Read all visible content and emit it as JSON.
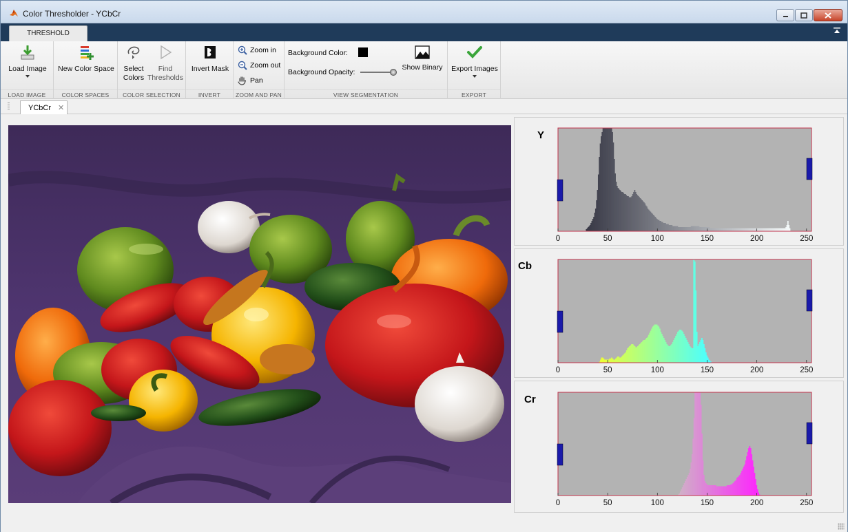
{
  "window": {
    "title": "Color Thresholder - YCbCr"
  },
  "tabs": {
    "threshold_label": "THRESHOLD"
  },
  "ribbon": {
    "load_image": "Load Image",
    "new_color_space": "New Color Space",
    "select_colors_1": "Select",
    "select_colors_2": "Colors",
    "find_thresholds_1": "Find",
    "find_thresholds_2": "Thresholds",
    "invert_mask": "Invert Mask",
    "zoom_in": "Zoom in",
    "zoom_out": "Zoom out",
    "pan": "Pan",
    "background_color": "Background Color:",
    "background_color_value": "#000000",
    "background_opacity": "Background Opacity:",
    "background_opacity_level": 1.0,
    "show_binary": "Show Binary",
    "export_images": "Export Images",
    "groups": {
      "load_image": "LOAD IMAGE",
      "color_spaces": "COLOR SPACES",
      "color_selection": "COLOR SELECTION",
      "invert": "INVERT",
      "zoom_and_pan": "ZOOM AND PAN",
      "view_segmentation": "VIEW SEGMENTATION",
      "export": "EXPORT"
    }
  },
  "document": {
    "tab_label": "YCbCr"
  },
  "histograms": {
    "ticks": [
      "0",
      "50",
      "100",
      "150",
      "200",
      "250"
    ],
    "y": {
      "label": "Y"
    },
    "cb": {
      "label": "Cb"
    },
    "cr": {
      "label": "Cr"
    }
  },
  "colors": {
    "slider_handle": "#1a1aaa",
    "histogram_background": "#b3b3b3",
    "histogram_border": "#c0304a"
  },
  "chart_data": [
    {
      "type": "area",
      "series": [
        {
          "name": "Y",
          "values": [
            0,
            0,
            0,
            0,
            0,
            0,
            0,
            0,
            0,
            0,
            0,
            0,
            0,
            0,
            0,
            0,
            0,
            0,
            0,
            0,
            0,
            0,
            0,
            0,
            0,
            0,
            0,
            0,
            0,
            0,
            2,
            3,
            4,
            5,
            6,
            8,
            10,
            12,
            14,
            18,
            22,
            30,
            40,
            55,
            72,
            85,
            92,
            96,
            100,
            100,
            100,
            100,
            100,
            100,
            100,
            100,
            100,
            100,
            96,
            86,
            70,
            56,
            48,
            44,
            42,
            41,
            40,
            39,
            38,
            38,
            37,
            36,
            36,
            35,
            34,
            34,
            33,
            33,
            33,
            34,
            36,
            38,
            40,
            38,
            36,
            35,
            34,
            33,
            32,
            31,
            30,
            29,
            28,
            27,
            25,
            24,
            22,
            21,
            20,
            19,
            18,
            17,
            16,
            15,
            14,
            13,
            12,
            11,
            11,
            10,
            10,
            9,
            9,
            8,
            8,
            8,
            7,
            7,
            7,
            6,
            6,
            6,
            6,
            5,
            5,
            5,
            5,
            5,
            5,
            4,
            4,
            4,
            4,
            4,
            4,
            4,
            4,
            4,
            4,
            4,
            4,
            4,
            4,
            5,
            5,
            5,
            5,
            5,
            5,
            5,
            5,
            5,
            4,
            4,
            4,
            4,
            4,
            4,
            4,
            4,
            4,
            4,
            4,
            3,
            3,
            3,
            3,
            3,
            3,
            3,
            3,
            3,
            3,
            3,
            3,
            3,
            3,
            3,
            3,
            3,
            3,
            3,
            3,
            3,
            3,
            3,
            3,
            3,
            3,
            3,
            3,
            3,
            3,
            3,
            3,
            3,
            3,
            3,
            3,
            3,
            3,
            3,
            3,
            3,
            3,
            3,
            3,
            3,
            3,
            3,
            3,
            3,
            3,
            3,
            3,
            3,
            3,
            3,
            3,
            3,
            3,
            3,
            3,
            3,
            3,
            3,
            3,
            3,
            3,
            3,
            3,
            3,
            3,
            3,
            3,
            3,
            3,
            3,
            3,
            3,
            3,
            3,
            3,
            3,
            3,
            4,
            6,
            10,
            6,
            3,
            0,
            0,
            0,
            0,
            0,
            0,
            0,
            0,
            0,
            0,
            0,
            0,
            0,
            0,
            0,
            0,
            0,
            0,
            0,
            0,
            0,
            0,
            0
          ]
        }
      ],
      "xlim": [
        0,
        255
      ],
      "lower_threshold": 0,
      "upper_threshold": 255
    },
    {
      "type": "area",
      "series": [
        {
          "name": "Cb",
          "values": [
            0,
            0,
            0,
            0,
            0,
            0,
            0,
            0,
            0,
            0,
            0,
            0,
            0,
            0,
            0,
            0,
            0,
            0,
            0,
            0,
            0,
            0,
            0,
            0,
            0,
            0,
            0,
            0,
            0,
            0,
            0,
            0,
            0,
            0,
            0,
            0,
            0,
            0,
            0,
            0,
            0,
            1,
            3,
            5,
            5,
            4,
            3,
            3,
            3,
            3,
            3,
            4,
            4,
            5,
            4,
            3,
            3,
            4,
            5,
            6,
            6,
            5,
            5,
            6,
            7,
            8,
            9,
            10,
            12,
            14,
            15,
            16,
            17,
            18,
            18,
            17,
            16,
            15,
            15,
            16,
            17,
            18,
            19,
            20,
            21,
            22,
            22,
            23,
            24,
            25,
            27,
            29,
            31,
            33,
            35,
            36,
            37,
            37,
            37,
            36,
            35,
            33,
            30,
            28,
            26,
            24,
            22,
            20,
            18,
            17,
            16,
            16,
            17,
            18,
            20,
            22,
            24,
            26,
            28,
            30,
            31,
            32,
            32,
            31,
            30,
            28,
            26,
            24,
            22,
            20,
            18,
            16,
            15,
            14,
            14,
            100,
            98,
            70,
            30,
            16,
            18,
            20,
            22,
            24,
            22,
            18,
            14,
            10,
            7,
            5,
            3,
            2,
            1,
            0,
            0,
            0,
            0,
            0,
            0,
            0,
            0,
            0,
            0,
            0,
            0,
            0,
            0,
            0,
            0,
            0,
            0,
            0,
            0,
            0,
            0,
            0,
            0,
            0,
            0,
            0,
            0,
            0,
            0,
            0,
            0,
            0,
            0,
            0,
            0,
            0,
            0,
            0,
            0,
            0,
            0,
            0,
            0,
            0,
            0,
            0,
            0,
            0,
            0,
            0,
            0,
            0,
            0,
            0,
            0,
            0,
            0,
            0,
            0,
            0,
            0,
            0,
            0,
            0,
            0,
            0,
            0,
            0,
            0,
            0,
            0,
            0,
            0,
            0,
            0,
            0,
            0,
            0,
            0,
            0,
            0,
            0,
            0,
            0,
            0,
            0,
            0,
            0,
            0,
            0,
            0,
            0,
            0,
            0,
            0,
            0,
            0,
            0,
            0
          ]
        }
      ],
      "xlim": [
        0,
        255
      ],
      "lower_threshold": 0,
      "upper_threshold": 255
    },
    {
      "type": "area",
      "series": [
        {
          "name": "Cr",
          "values": [
            0,
            0,
            0,
            0,
            0,
            0,
            0,
            0,
            0,
            0,
            0,
            0,
            0,
            0,
            0,
            0,
            0,
            0,
            0,
            0,
            0,
            0,
            0,
            0,
            0,
            0,
            0,
            0,
            0,
            0,
            0,
            0,
            0,
            0,
            0,
            0,
            0,
            0,
            0,
            0,
            0,
            0,
            0,
            0,
            0,
            0,
            0,
            0,
            0,
            0,
            0,
            0,
            0,
            0,
            0,
            0,
            0,
            0,
            0,
            0,
            0,
            0,
            0,
            0,
            0,
            0,
            0,
            0,
            0,
            0,
            0,
            0,
            0,
            0,
            0,
            0,
            0,
            0,
            0,
            0,
            0,
            0,
            0,
            0,
            0,
            0,
            0,
            0,
            0,
            0,
            0,
            0,
            0,
            0,
            0,
            0,
            0,
            0,
            0,
            0,
            0,
            0,
            0,
            0,
            0,
            0,
            0,
            0,
            0,
            0,
            0,
            0,
            0,
            0,
            0,
            0,
            0,
            0,
            0,
            0,
            0,
            0,
            0,
            1,
            2,
            4,
            6,
            8,
            10,
            12,
            14,
            16,
            18,
            20,
            22,
            26,
            32,
            40,
            55,
            75,
            100,
            100,
            100,
            100,
            100,
            100,
            88,
            60,
            34,
            20,
            14,
            12,
            11,
            10,
            10,
            10,
            10,
            10,
            10,
            10,
            10,
            10,
            9,
            9,
            9,
            9,
            9,
            9,
            9,
            9,
            9,
            9,
            9,
            10,
            10,
            10,
            10,
            11,
            11,
            12,
            13,
            14,
            15,
            17,
            18,
            19,
            20,
            22,
            24,
            26,
            28,
            30,
            34,
            38,
            42,
            46,
            48,
            46,
            40,
            34,
            28,
            22,
            16,
            10,
            6,
            3,
            1,
            0,
            0,
            0,
            0,
            0,
            0,
            0,
            0,
            0,
            0,
            0,
            0,
            0,
            0,
            0,
            0,
            0,
            0,
            0,
            0,
            0,
            0,
            0,
            0,
            0,
            0,
            0,
            0,
            0,
            0,
            0,
            0,
            0,
            0,
            0,
            0,
            0,
            0,
            0,
            0,
            0,
            0,
            0,
            0,
            0,
            0,
            0,
            0,
            0,
            0,
            0,
            0,
            0
          ]
        }
      ],
      "xlim": [
        0,
        255
      ],
      "lower_threshold": 0,
      "upper_threshold": 255
    }
  ]
}
